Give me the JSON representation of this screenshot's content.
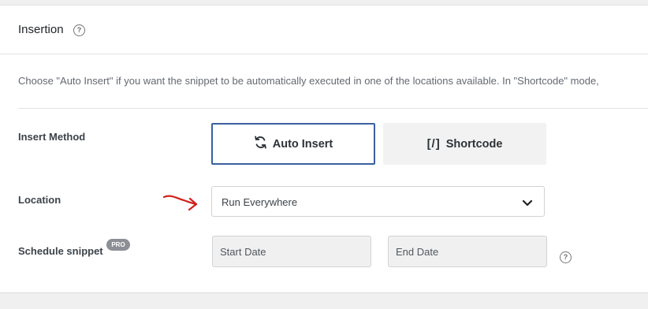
{
  "section": {
    "title": "Insertion",
    "description": "Choose \"Auto Insert\" if you want the snippet to be automatically executed in one of the locations available. In \"Shortcode\" mode,"
  },
  "insert_method": {
    "label": "Insert Method",
    "options": [
      {
        "label": "Auto Insert",
        "icon": "refresh-icon",
        "active": true
      },
      {
        "label": "Shortcode",
        "icon": "shortcode-brackets-icon",
        "active": false
      }
    ]
  },
  "location": {
    "label": "Location",
    "selected": "Run Everywhere"
  },
  "schedule": {
    "label": "Schedule snippet",
    "badge": "PRO",
    "start_placeholder": "Start Date",
    "end_placeholder": "End Date"
  },
  "colors": {
    "active_border": "#3a5fa0",
    "annotation_arrow": "#d0211c",
    "badge": "#8c8f94"
  }
}
